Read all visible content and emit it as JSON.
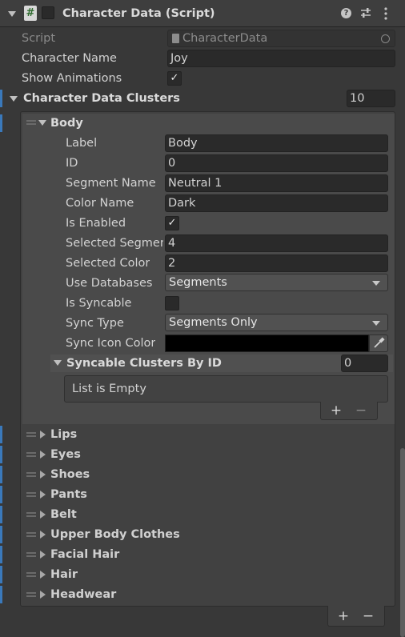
{
  "header": {
    "title": "Character Data (Script)",
    "script_icon_glyph": "#"
  },
  "fields": {
    "script_label": "Script",
    "script_value": "CharacterData",
    "char_name_label": "Character Name",
    "char_name_value": "Joy",
    "show_anim_label": "Show Animations",
    "clusters_label": "Character Data Clusters",
    "clusters_count": "10"
  },
  "body_cluster": {
    "name": "Body",
    "label_label": "Label",
    "label_value": "Body",
    "id_label": "ID",
    "id_value": "0",
    "segment_name_label": "Segment Name",
    "segment_name_value": "Neutral 1",
    "color_name_label": "Color Name",
    "color_name_value": "Dark",
    "is_enabled_label": "Is Enabled",
    "selected_segment_label": "Selected Segment",
    "selected_segment_value": "4",
    "selected_color_label": "Selected Color",
    "selected_color_value": "2",
    "use_databases_label": "Use Databases",
    "use_databases_value": "Segments",
    "is_syncable_label": "Is Syncable",
    "sync_type_label": "Sync Type",
    "sync_type_value": "Segments Only",
    "sync_icon_color_label": "Sync Icon Color",
    "syncable_label": "Syncable Clusters By ID",
    "syncable_count": "0",
    "list_empty": "List is Empty"
  },
  "collapsed_items": [
    "Lips",
    "Eyes",
    "Shoes",
    "Pants",
    "Belt",
    "Upper Body Clothes",
    "Facial Hair",
    "Hair",
    "Headwear"
  ],
  "glyphs": {
    "check": "✓",
    "plus": "+",
    "minus": "−"
  },
  "colors": {
    "sync_icon_color": "#000000",
    "accent": "#3a79bb"
  }
}
